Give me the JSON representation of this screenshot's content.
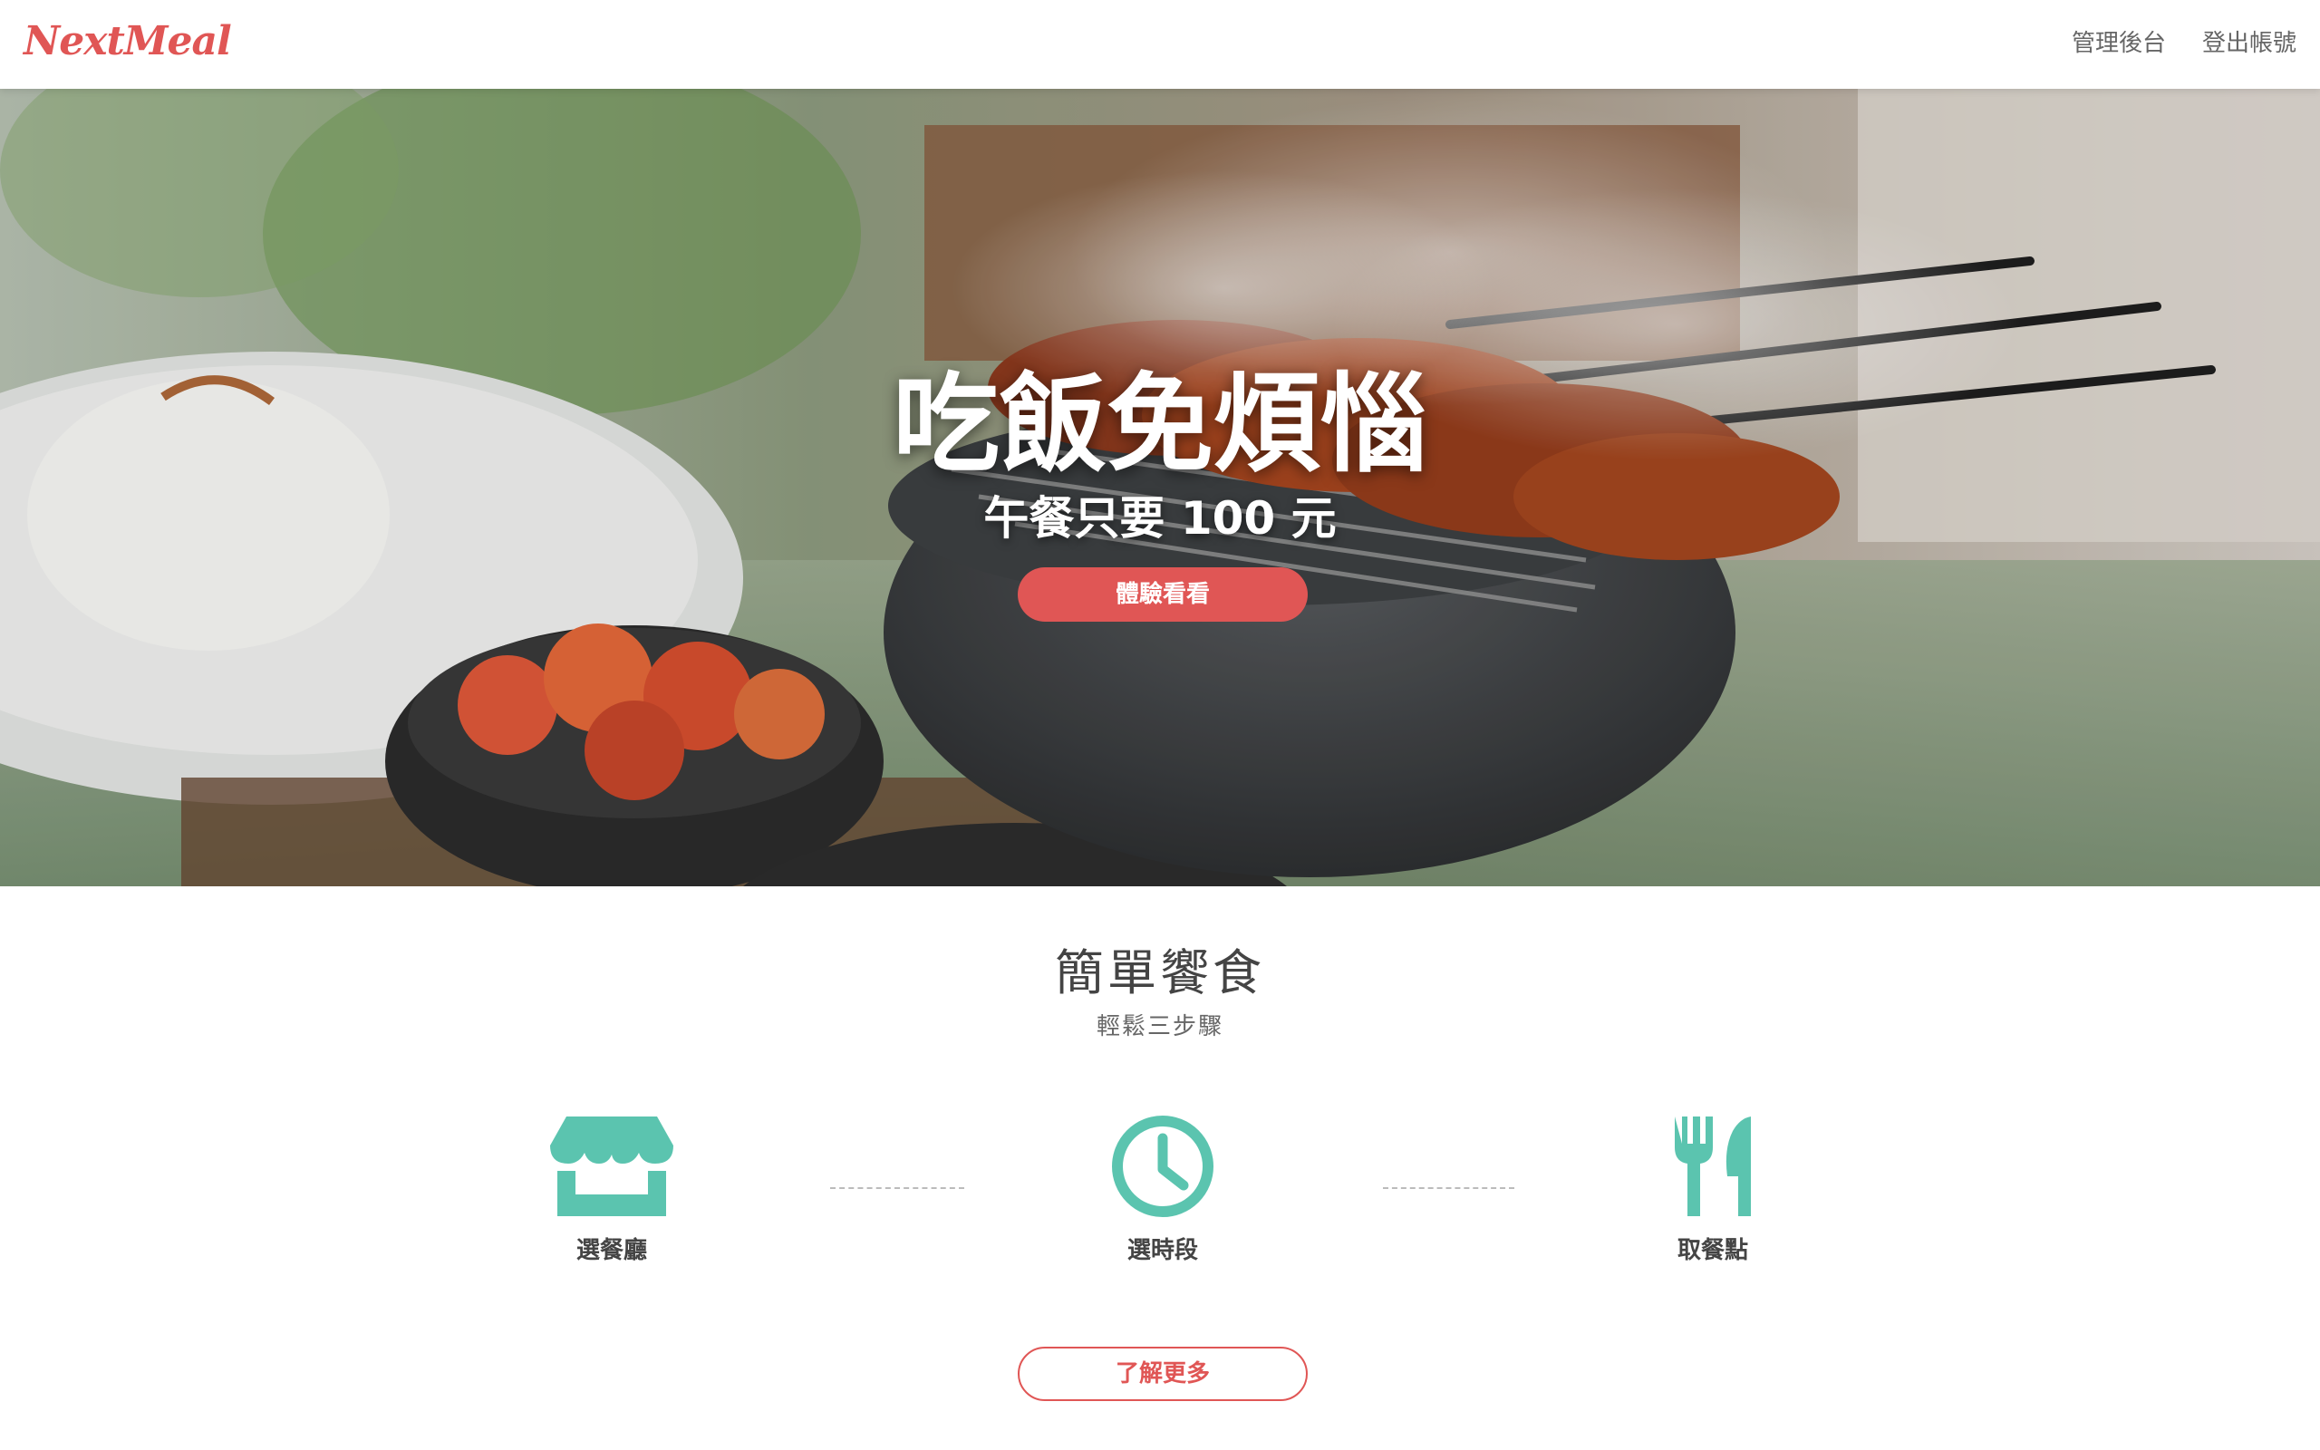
{
  "navbar": {
    "brand": "NextMeal",
    "links": [
      "管理後台",
      "登出帳號"
    ]
  },
  "hero": {
    "title": "吃飯免煩惱",
    "subtitle": "午餐只要 100 元",
    "cta_label": "體驗看看"
  },
  "steps_section": {
    "title": "簡單饗食",
    "subtitle": "輕鬆三步驟",
    "steps": [
      {
        "label": "選餐廳",
        "icon": "store-icon"
      },
      {
        "label": "選時段",
        "icon": "clock-icon"
      },
      {
        "label": "取餐點",
        "icon": "utensils-icon"
      }
    ]
  },
  "more_label": "了解更多",
  "colors": {
    "brand": "#e05655",
    "icon_teal": "#5bc4af",
    "text_dark": "#444444",
    "text_muted": "#666666"
  }
}
